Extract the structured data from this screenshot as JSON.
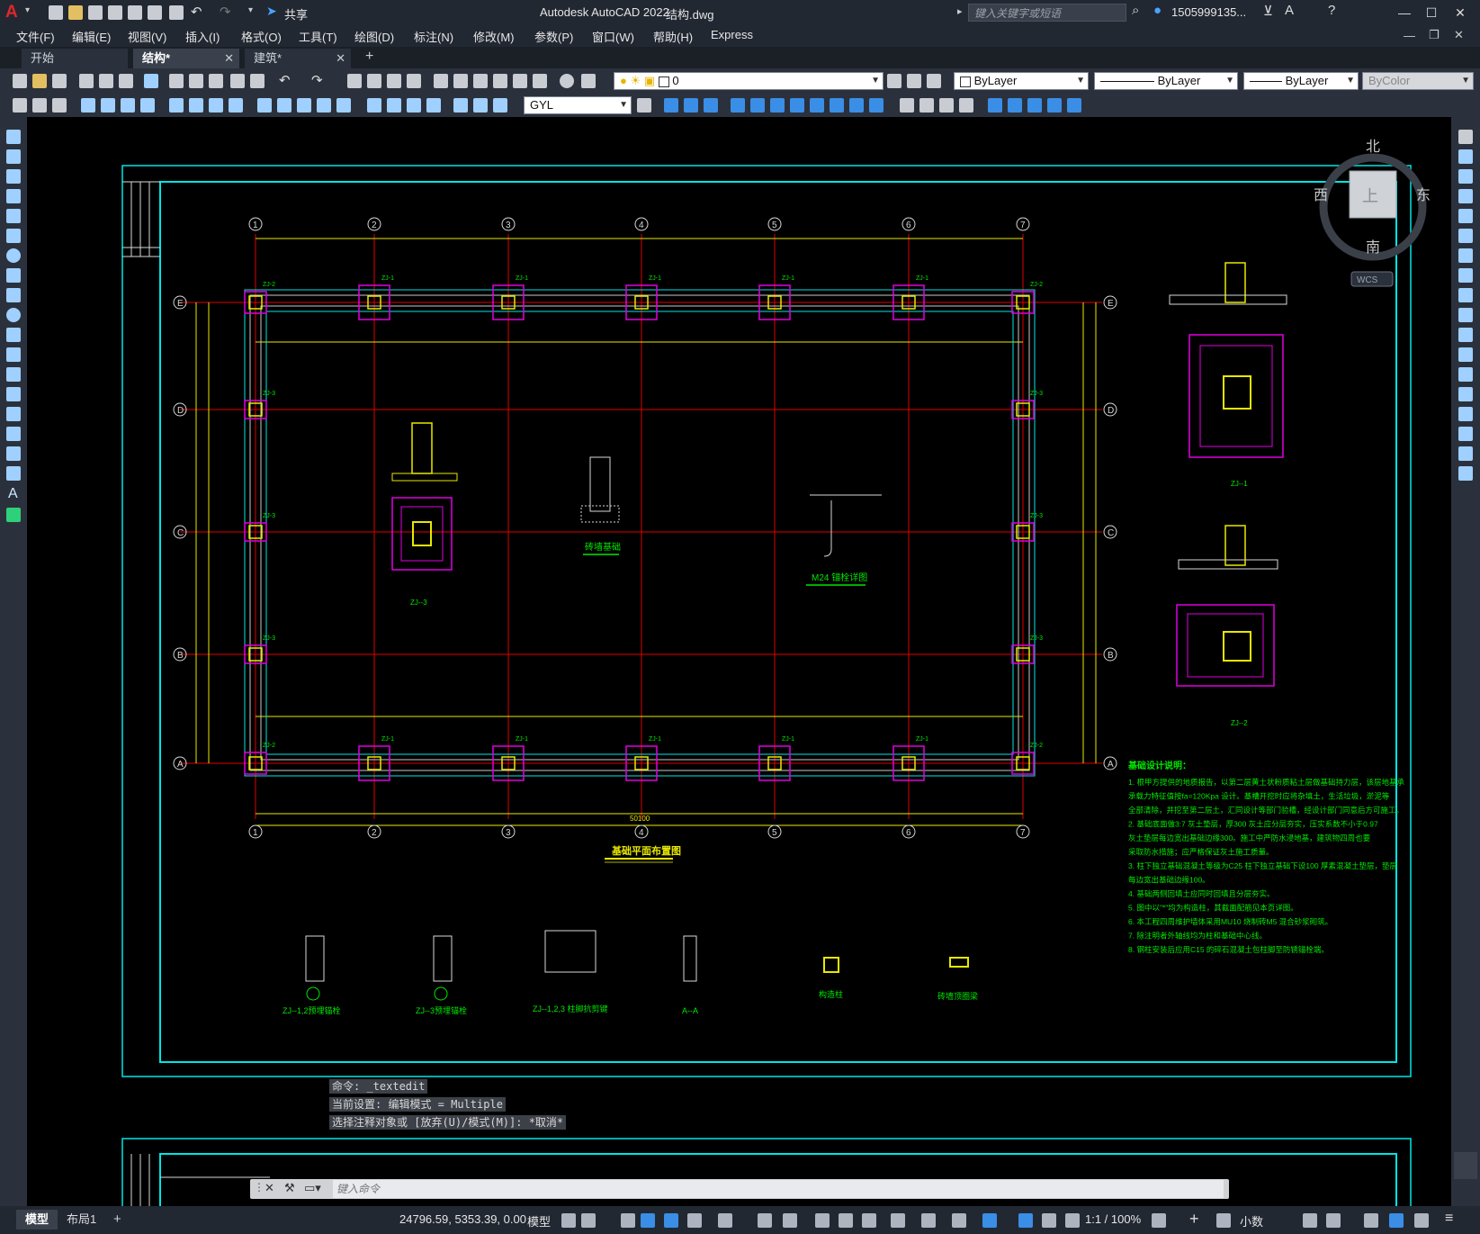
{
  "app": {
    "title": "Autodesk AutoCAD 2022",
    "filename": "结构.dwg",
    "logo": "A",
    "share_label": "共享",
    "search_placeholder": "键入关键字或短语",
    "user": "1505999135...",
    "colors": {
      "accent": "#3a8ee6",
      "logo": "#e0262b",
      "frame": "#00e5e5",
      "grid": "#e00000",
      "dims": "#e8e800",
      "text": "#00e800",
      "column": "#e000e0"
    }
  },
  "menu": [
    "文件(F)",
    "编辑(E)",
    "视图(V)",
    "插入(I)",
    "格式(O)",
    "工具(T)",
    "绘图(D)",
    "标注(N)",
    "修改(M)",
    "参数(P)",
    "窗口(W)",
    "帮助(H)",
    "Express"
  ],
  "tabs": [
    {
      "label": "开始"
    },
    {
      "label": "结构*"
    },
    {
      "label": "建筑*"
    }
  ],
  "toolbar": {
    "layer_value": "0",
    "color_value": "ByLayer",
    "linetype_value": "ByLayer",
    "lineweight_value": "ByLayer",
    "plotstyle_value": "ByColor",
    "textstyle_value": "GYL"
  },
  "viewcube": {
    "north": "北",
    "south": "南",
    "east": "东",
    "west": "西",
    "top": "上",
    "wcs": "WCS"
  },
  "drawing": {
    "axis_numbers": [
      "1",
      "2",
      "3",
      "4",
      "5",
      "6",
      "7"
    ],
    "axis_letters": [
      "E",
      "D",
      "C",
      "B",
      "A"
    ],
    "main_title": "基础平面布置图",
    "total_dim": "50100",
    "col_labels": {
      "zj1": "ZJ-1",
      "zj2": "ZJ-2",
      "zj3": "ZJ-3"
    },
    "detail_titles": {
      "brick": "砖墙基础",
      "anchor": "M24 锚栓详图",
      "zj3": "ZJ--3",
      "zj1": "ZJ--1",
      "zj2": "ZJ--2",
      "b1": "ZJ--1,2预埋锚栓",
      "b2": "ZJ--3预埋锚栓",
      "b3": "ZJ--1,2,3 柱脚抗剪键",
      "b4": "A--A",
      "b5": "构造柱",
      "b6": "砖墙顶圈梁"
    },
    "notes_title": "基础设计说明：",
    "notes": [
      "1. 根甲方提供的地质报告，以第二层黄土状粉质粘土层做基础持力层，该层地基承",
      "   承载力特征值按fa=120Kpa 设计。基槽开挖时应将杂填土，生活垃圾，淤泥等",
      "   全部清除，并挖至第二层土，汇同设计等部门验槽，经设计部门同意后方可施工。",
      "2. 基础底面做3:7 灰土垫层，厚300 灰土应分层夯实，压实系数不小于0.97",
      "   灰土垫层每边宽出基础边缘300。施工中严防水浸地基，建筑物四周也要",
      "   采取防水措施；应严格保证灰土施工质量。",
      "3. 柱下独立基础混凝土等级为C25 柱下独立基础下设100 厚素混凝土垫层，垫层",
      "   每边宽出基础边缘100。",
      "4. 基础两侧回填土应同时回填且分层夯实。",
      "5. 图中以\"*\"均为构造柱，其截面配筋见本页详图。",
      "6. 本工程四周维护墙体采用MU10 烧制砖M5 混合砂浆砌筑。",
      "7. 除注明者外轴线均为柱和基础中心线。",
      "8. 钢柱安装后应用C15 的碎石混凝土包柱脚至防锈锚栓端。"
    ]
  },
  "command": {
    "history": [
      "命令: _textedit",
      "当前设置: 编辑模式 = Multiple",
      "选择注释对象或 [放弃(U)/模式(M)]: *取消*"
    ],
    "placeholder": "键入命令"
  },
  "status": {
    "layout_tabs": [
      "模型",
      "布局1"
    ],
    "coords": "24796.59, 5353.39, 0.00",
    "space": "模型",
    "scale": "1:1 / 100%",
    "units": "小数"
  }
}
